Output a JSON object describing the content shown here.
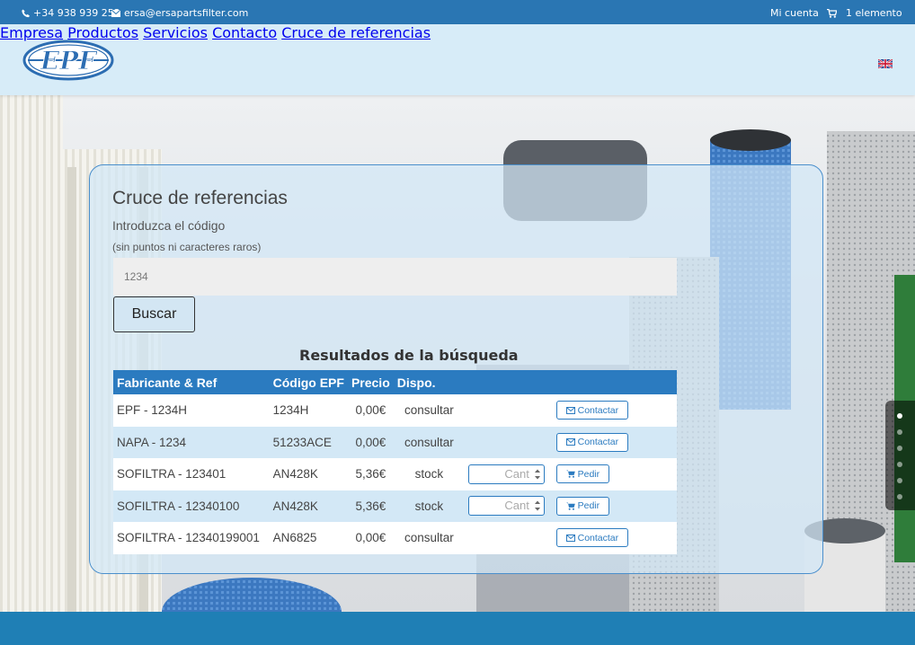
{
  "topbar": {
    "phone": "+34 938 939 252",
    "email": "ersa@ersapartsfilter.com",
    "account": "Mi cuenta",
    "cart": "1 elemento",
    "icons": [
      "phone-icon",
      "envelope-icon",
      "cart-icon"
    ]
  },
  "header": {
    "logo_text": "EPF",
    "nav": [
      "Empresa",
      "Productos",
      "Servicios",
      "Contacto",
      "Cruce de referencias"
    ],
    "language_flag": "uk-flag-icon"
  },
  "panel": {
    "title": "Cruce de referencias",
    "subtitle": "Introduzca el código",
    "note": "(sin puntos ni caracteres raros)",
    "search_value": "1234",
    "search_button": "Buscar",
    "results_title": "Resultados de la búsqueda"
  },
  "table": {
    "headers": [
      "Fabricante & Ref",
      "Código EPF",
      "Precio",
      "Dispo."
    ],
    "qty_placeholder": "Cant",
    "rows": [
      {
        "ref": "EPF - 1234H",
        "code": "1234H",
        "price": "0,00€",
        "dispo": "consultar",
        "action": "Contactar",
        "has_qty": false
      },
      {
        "ref": "NAPA - 1234",
        "code": "51233ACE",
        "price": "0,00€",
        "dispo": "consultar",
        "action": "Contactar",
        "has_qty": false
      },
      {
        "ref": "SOFILTRA - 123401",
        "code": "AN428K",
        "price": "5,36€",
        "dispo": "stock",
        "action": "Pedir",
        "has_qty": true
      },
      {
        "ref": "SOFILTRA - 12340100",
        "code": "AN428K",
        "price": "5,36€",
        "dispo": "stock",
        "action": "Pedir",
        "has_qty": true
      },
      {
        "ref": "SOFILTRA - 12340199001",
        "code": "AN6825",
        "price": "0,00€",
        "dispo": "consultar",
        "action": "Contactar",
        "has_qty": false
      }
    ]
  },
  "slider": {
    "count": 6,
    "active": 0
  },
  "colors": {
    "topbar": "#2a76b3",
    "header": "#d7ecf8",
    "accent": "#2b7bc0",
    "footer": "#1f7fb5"
  }
}
